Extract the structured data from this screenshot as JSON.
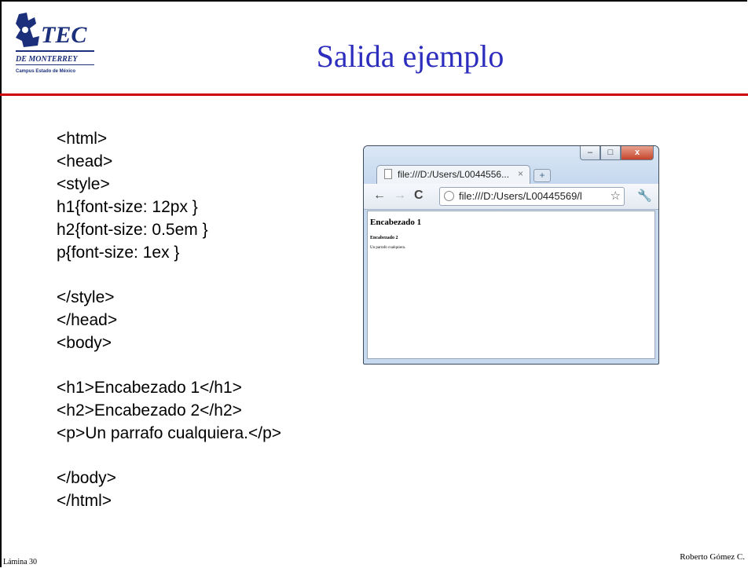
{
  "slide": {
    "title": "Salida ejemplo",
    "footer_left": "Lámina 30",
    "footer_right": "Roberto Gómez C.",
    "accent_color": "#cc0000",
    "title_color": "#2e2ebe"
  },
  "logo": {
    "name": "TEC",
    "subtitle": "DE MONTERREY",
    "campus": "Campus Estado de México"
  },
  "code_lines": [
    "<html>",
    "<head>",
    "<style>",
    "h1{font-size: 12px }",
    "h2{font-size: 0.5em }",
    "p{font-size: 1ex }",
    "",
    "</style>",
    "</head>",
    "<body>",
    "",
    "<h1>Encabezado 1</h1>",
    "<h2>Encabezado 2</h2>",
    "<p>Un parrafo cualquiera.</p>",
    "",
    "</body>",
    "</html>"
  ],
  "browser": {
    "tab_title": "file:///D:/Users/L0044556...",
    "tab_close": "×",
    "new_tab_icon": "+",
    "back_icon": "←",
    "forward_icon": "→",
    "reload_icon": "C",
    "url": "file:///D:/Users/L00445569/l",
    "star_icon": "☆",
    "wrench_icon": "🔧",
    "window_minimize": "–",
    "window_maximize": "□",
    "window_close": "x",
    "page": {
      "h1": "Encabezado 1",
      "h2": "Encabezado 2",
      "p": "Un parrafo cualquiera."
    }
  }
}
